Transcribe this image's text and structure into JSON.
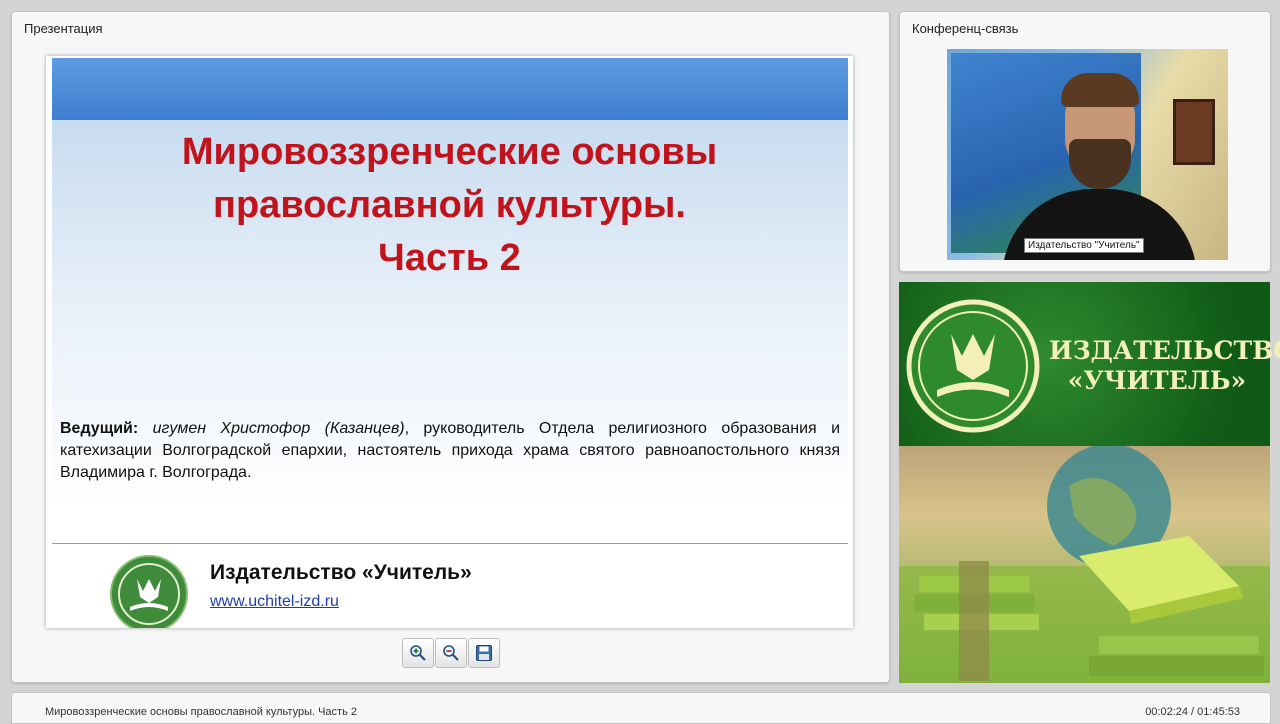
{
  "presentation_panel": {
    "title": "Презентация"
  },
  "slide": {
    "title_lines": [
      "Мировоззренческие основы",
      "православной культуры.",
      "Часть 2"
    ],
    "presenter": {
      "role": "Ведущий:",
      "name": "игумен Христофор (Казанцев)",
      "rest": ", руководитель Отдела религиозного образования и катехизации Волгоградской епархии, настоятель прихода храма святого равноапостольного князя Владимира г. Волгограда."
    },
    "publisher": "Издательство «Учитель»",
    "url": "www.uchitel-izd.ru"
  },
  "toolbar": {
    "zoom_in_icon": "zoom-in-icon",
    "zoom_out_icon": "zoom-out-icon",
    "save_icon": "save-icon"
  },
  "conference_panel": {
    "title": "Конференц-связь",
    "video_label": "Издательство \"Учитель\""
  },
  "banner": {
    "line1": "ИЗДАТЕЛЬСТВО",
    "line2": "«УЧИТЕЛЬ»"
  },
  "status": {
    "title": "Мировоззренческие основы православной культуры. Часть 2",
    "time": "00:02:24 / 01:45:53"
  },
  "colors": {
    "slide_title": "#c0131b",
    "brand_green": "#0f5a17",
    "brand_text": "#f2f0b8",
    "header_band": "#4f8ddb"
  }
}
